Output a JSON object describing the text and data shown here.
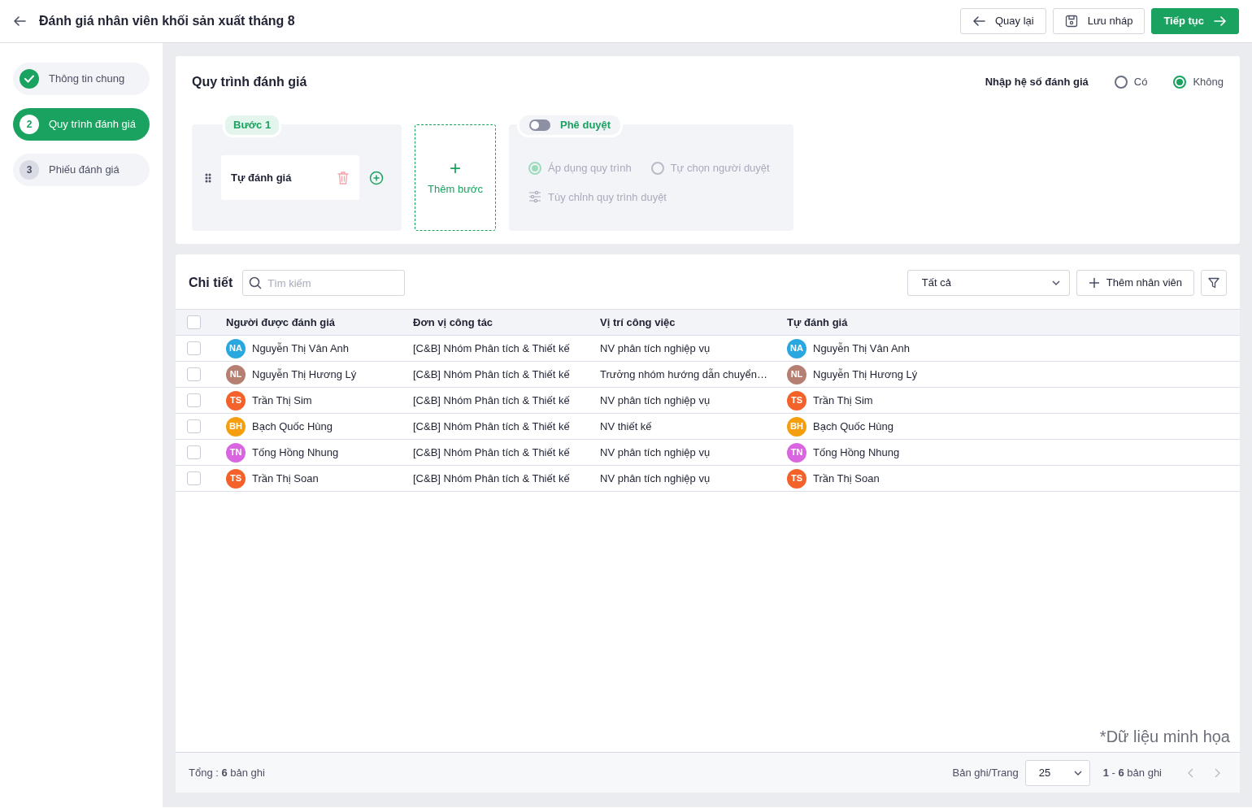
{
  "header": {
    "title": "Đánh giá nhân viên khối sản xuất tháng 8",
    "buttons": [
      {
        "kind": "back",
        "label": "Quay lại"
      },
      {
        "kind": "save",
        "label": "Lưu nháp"
      },
      {
        "kind": "next",
        "label": "Tiếp tục"
      }
    ]
  },
  "steps": [
    {
      "label": "Thông tin chung",
      "done": true,
      "selected": false
    },
    {
      "number": "2",
      "label": "Quy trình đánh giá",
      "done": false,
      "selected": true
    },
    {
      "number": "3",
      "label": "Phiếu đánh giá",
      "done": false,
      "selected": false
    }
  ],
  "process": {
    "title": "Quy trình đánh giá",
    "coefficient": {
      "label": "Nhập hệ số đánh giá",
      "options": [
        {
          "label": "Có",
          "selected": false
        },
        {
          "label": "Không",
          "selected": true
        }
      ]
    },
    "step": {
      "tag": "Bước 1",
      "item": "Tự đánh giá"
    },
    "add_step": {
      "plus": "+",
      "label": "Thêm bước"
    },
    "approval": {
      "label": "Phê duyệt",
      "on": false,
      "options": [
        {
          "label": "Áp dụng quy trình",
          "selected": true
        },
        {
          "label": "Tự chọn người duyệt",
          "selected": false
        }
      ],
      "customize": "Tùy chỉnh quy trình duyệt"
    }
  },
  "detail": {
    "title": "Chi tiết",
    "search": {
      "placeholder": "Tìm kiếm"
    },
    "filter_select": "Tất cả",
    "add_button": "Thêm nhân viên",
    "all_checked": false,
    "columns": [
      "Người được đánh giá",
      "Đơn vị công tác",
      "Vị trí công việc",
      "Tự đánh giá"
    ],
    "rows": [
      {
        "checked": false,
        "initials": "NA",
        "color": "#29a8e0",
        "name": "Nguyễn Thị Vân Anh",
        "unit": "[C&B] Nhóm Phân tích & Thiết kế",
        "position": "NV phân tích nghiệp vụ",
        "self_initials": "NA",
        "self_name": "Nguyễn Thị Vân Anh"
      },
      {
        "checked": false,
        "initials": "NL",
        "color": "#b57f72",
        "name": "Nguyễn Thị Hương Lý",
        "unit": "[C&B] Nhóm Phân tích & Thiết kế",
        "position": "Trưởng nhóm hướng dẫn chuyển…",
        "self_initials": "NL",
        "self_name": "Nguyễn Thị Hương Lý"
      },
      {
        "checked": false,
        "initials": "TS",
        "color": "#f4622b",
        "name": "Trần Thị Sim",
        "unit": "[C&B] Nhóm Phân tích & Thiết kế",
        "position": "NV phân tích nghiệp vụ",
        "self_initials": "TS",
        "self_name": "Trần Thị Sim"
      },
      {
        "checked": false,
        "initials": "BH",
        "color": "#f59f0f",
        "name": "Bạch Quốc Hùng",
        "unit": "[C&B] Nhóm Phân tích & Thiết kế",
        "position": "NV thiết kế",
        "self_initials": "BH",
        "self_name": "Bạch Quốc Hùng"
      },
      {
        "checked": false,
        "initials": "TN",
        "color": "#d966e0",
        "name": "Tống Hồng Nhung",
        "unit": "[C&B] Nhóm Phân tích & Thiết kế",
        "position": "NV phân tích nghiệp vụ",
        "self_initials": "TN",
        "self_name": "Tống Hồng Nhung"
      },
      {
        "checked": false,
        "initials": "TS",
        "color": "#f4622b",
        "name": "Trần Thị Soan",
        "unit": "[C&B] Nhóm Phân tích & Thiết kế",
        "position": "NV phân tích nghiệp vụ",
        "self_initials": "TS",
        "self_name": "Trần Thị Soan"
      }
    ],
    "note": "*Dữ liệu minh họa",
    "footer": {
      "total": "Tổng : **6** bản ghi",
      "per_page_label": "Bản ghi/Trang",
      "per_page": "25",
      "range": "**1** - **6** bản ghi"
    }
  }
}
